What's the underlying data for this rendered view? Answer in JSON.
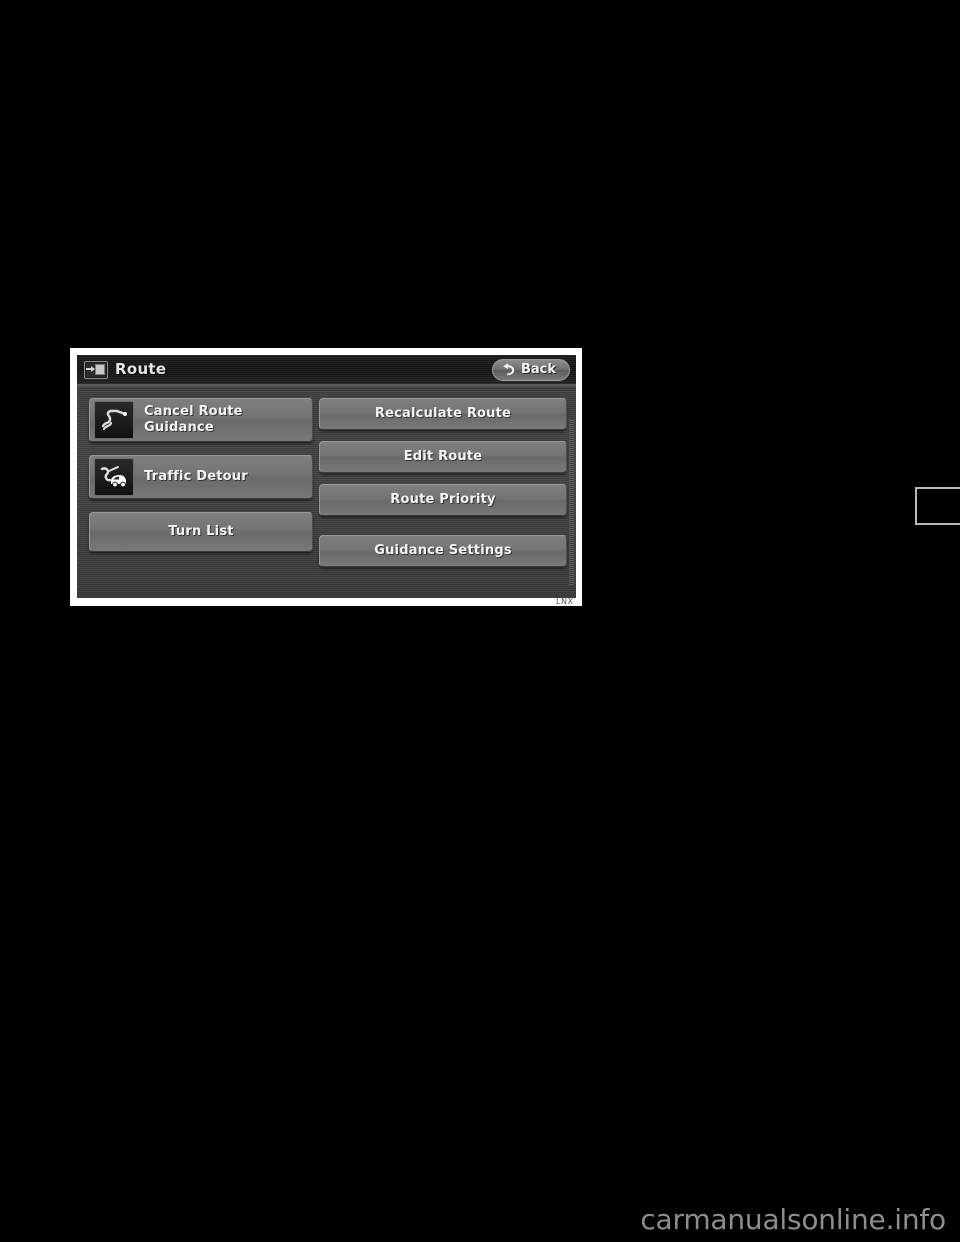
{
  "page": {
    "background_color": "#000000",
    "watermark": "carmanualsonline.info",
    "figure_code": "LNX"
  },
  "page_tab": {
    "border_color": "#b9b9b9"
  },
  "nav_screen": {
    "frame_color": "#ffffff",
    "background_color": "#3f3f3f",
    "title_bar": {
      "icon": "screen-display-icon",
      "title": "Route",
      "back_button": {
        "label": "Back",
        "icon": "back-arrow-icon"
      }
    },
    "buttons": {
      "left_column": [
        {
          "label": "Cancel Route Guidance",
          "icon": "winding-route-icon",
          "has_icon": true,
          "name": "cancel-route-guidance-button"
        },
        {
          "label": "Traffic Detour",
          "icon": "car-detour-icon",
          "has_icon": true,
          "name": "traffic-detour-button"
        },
        {
          "label": "Turn List",
          "icon": null,
          "has_icon": false,
          "name": "turn-list-button"
        }
      ],
      "right_column": [
        {
          "label": "Recalculate Route",
          "name": "recalculate-route-button"
        },
        {
          "label": "Edit Route",
          "name": "edit-route-button"
        },
        {
          "label": "Route Priority",
          "name": "route-priority-button"
        },
        {
          "label": "Guidance Settings",
          "name": "guidance-settings-button"
        }
      ]
    }
  }
}
